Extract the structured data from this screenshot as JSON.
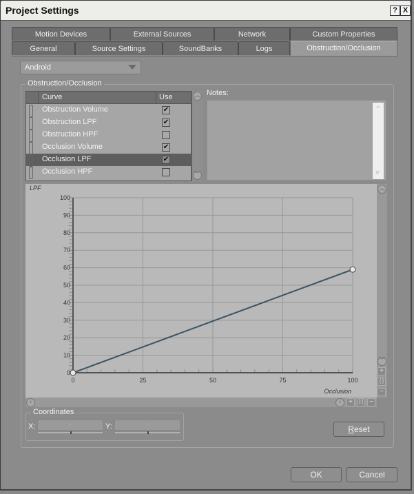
{
  "window": {
    "title": "Project Settings",
    "help_label": "?",
    "close_label": "X"
  },
  "tabs_row1": [
    {
      "label": "Motion Devices",
      "active": false
    },
    {
      "label": "External Sources",
      "active": false
    },
    {
      "label": "Network",
      "active": false
    },
    {
      "label": "Custom Properties",
      "active": false
    }
  ],
  "tabs_row2": [
    {
      "label": "General",
      "active": false
    },
    {
      "label": "Source Settings",
      "active": false
    },
    {
      "label": "SoundBanks",
      "active": false
    },
    {
      "label": "Logs",
      "active": false
    },
    {
      "label": "Obstruction/Occlusion",
      "active": true
    }
  ],
  "platform_dropdown": {
    "selected": "Android"
  },
  "group": {
    "label": "Obstruction/Occlusion"
  },
  "curve_table": {
    "headers": {
      "curve": "Curve",
      "use": "Use"
    },
    "rows": [
      {
        "name": "Obstruction Volume",
        "use": true,
        "selected": false
      },
      {
        "name": "Obstruction LPF",
        "use": true,
        "selected": false
      },
      {
        "name": "Obstruction HPF",
        "use": false,
        "selected": false
      },
      {
        "name": "Occlusion Volume",
        "use": true,
        "selected": false
      },
      {
        "name": "Occlusion LPF",
        "use": true,
        "selected": true
      },
      {
        "name": "Occlusion HPF",
        "use": false,
        "selected": false
      }
    ]
  },
  "notes": {
    "label": "Notes:",
    "value": ""
  },
  "chart_data": {
    "type": "line",
    "title": "",
    "ylabel": "LPF",
    "xlabel": "Occlusion",
    "xlim": [
      0,
      100
    ],
    "ylim": [
      0,
      100
    ],
    "x_ticks": [
      "0",
      "25",
      "50",
      "75",
      "100"
    ],
    "x_tick_values": [
      0,
      25,
      50,
      75,
      100
    ],
    "y_ticks": [
      "0",
      "10",
      "20",
      "30",
      "40",
      "50",
      "60",
      "70",
      "80",
      "90",
      "100"
    ],
    "y_tick_values": [
      0,
      10,
      20,
      30,
      40,
      50,
      60,
      70,
      80,
      90,
      100
    ],
    "grid": true,
    "series": [
      {
        "name": "Occlusion LPF",
        "color": "#3d5566",
        "points": [
          [
            0,
            0
          ],
          [
            100,
            59
          ]
        ]
      }
    ]
  },
  "coordinates": {
    "label": "Coordinates",
    "x_label": "X:",
    "y_label": "Y:",
    "x_value": "-",
    "y_value": "-"
  },
  "buttons": {
    "reset_prefix": "R",
    "reset_rest": "eset",
    "ok": "OK",
    "cancel": "Cancel"
  },
  "zoom_controls": {
    "plus": "+",
    "fit": "[:]",
    "minus": "−"
  }
}
